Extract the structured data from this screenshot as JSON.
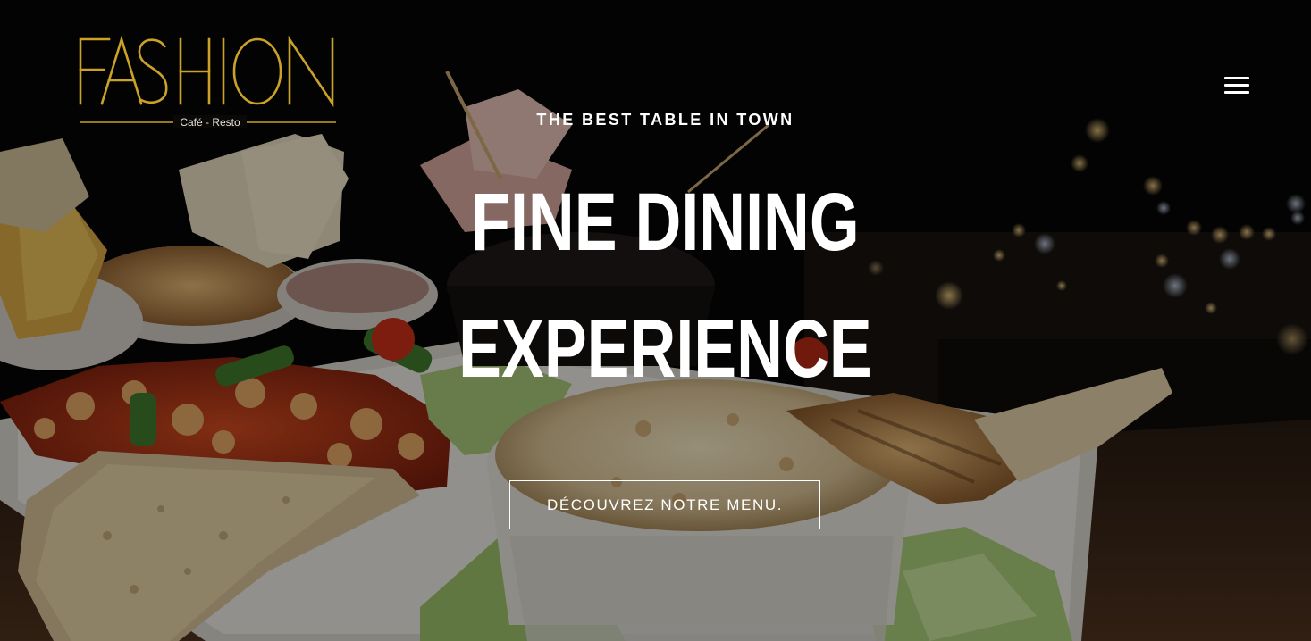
{
  "brand": {
    "name": "FASHION",
    "tagline": "Café - Resto",
    "gold_color": "#c9a227"
  },
  "nav": {
    "menu_icon": "hamburger-icon"
  },
  "hero": {
    "eyebrow": "THE BEST TABLE IN TOWN",
    "headline_line1": "FINE DINING",
    "headline_line2": "EXPERIENCE",
    "cta_label": "DÉCOUVREZ NOTRE MENU."
  }
}
